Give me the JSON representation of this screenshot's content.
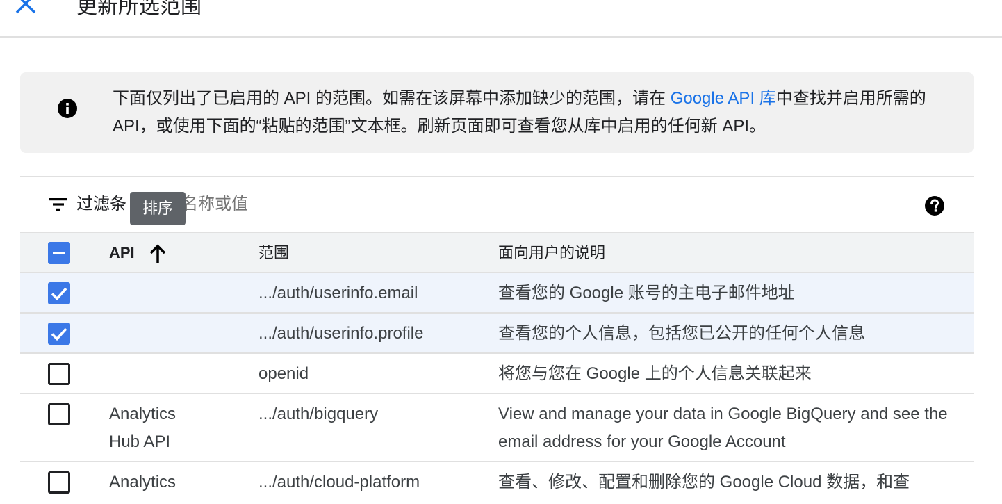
{
  "header": {
    "title": "更新所选范围"
  },
  "info": {
    "text_before_link": "下面仅列出了已启用的 API 的范围。如需在该屏幕中添加缺少的范围，请在 ",
    "link_text": "Google API 库",
    "text_after_link": "中查找并启用所需的 API，或使用下面的“粘贴的范围”文本框。刷新页面即可查看您从库中启用的任何新 API。"
  },
  "filter": {
    "label": "过滤条",
    "placeholder": "入属性名称或值"
  },
  "tooltip": {
    "text": "排序"
  },
  "table": {
    "headers": {
      "api": "API",
      "scope": "范围",
      "description": "面向用户的说明"
    },
    "rows": [
      {
        "checked": true,
        "api": "",
        "scope": ".../auth/userinfo.email",
        "description": "查看您的 Google 账号的主电子邮件地址"
      },
      {
        "checked": true,
        "api": "",
        "scope": ".../auth/userinfo.profile",
        "description": "查看您的个人信息，包括您已公开的任何个人信息"
      },
      {
        "checked": false,
        "api": "",
        "scope": "openid",
        "description": "将您与您在 Google 上的个人信息关联起来"
      },
      {
        "checked": false,
        "api": "Analytics Hub API",
        "scope": ".../auth/bigquery",
        "description": "View and manage your data in Google BigQuery and see the email address for your Google Account"
      },
      {
        "checked": false,
        "api": "Analytics",
        "scope": ".../auth/cloud-platform",
        "description": "查看、修改、配置和删除您的 Google Cloud 数据，和查"
      }
    ]
  },
  "colors": {
    "accent": "#1a73e8",
    "checkbox": "#3b78e7",
    "selected_row": "#eff4fc"
  },
  "icons": [
    "close-icon",
    "info-icon",
    "filter-icon",
    "help-icon",
    "sort-arrow-up-icon",
    "checkbox-indeterminate-icon",
    "checkbox-checked-icon"
  ]
}
